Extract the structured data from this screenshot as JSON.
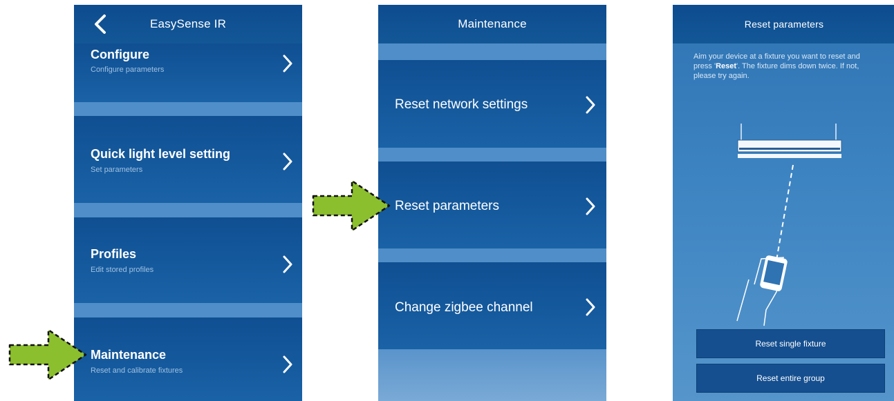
{
  "screen1": {
    "title": "EasySense IR",
    "items": [
      {
        "title": "Configure",
        "subtitle": "Configure parameters"
      },
      {
        "title": "Quick light level setting",
        "subtitle": "Set parameters"
      },
      {
        "title": "Profiles",
        "subtitle": "Edit stored profiles"
      },
      {
        "title": "Maintenance",
        "subtitle": "Reset and calibrate fixtures"
      }
    ]
  },
  "screen2": {
    "title": "Maintenance",
    "items": [
      {
        "title": "Reset network settings"
      },
      {
        "title": "Reset parameters"
      },
      {
        "title": "Change zigbee channel"
      }
    ]
  },
  "screen3": {
    "title": "Reset parameters",
    "description_before": "Aim your device at a fixture you want to reset and press '",
    "description_bold": "Reset",
    "description_after": "'. The fixture dims down twice. If not, please try again.",
    "buttons": {
      "single": "Reset single fixture",
      "group": "Reset entire group"
    }
  },
  "colors": {
    "highlight_arrow": "#8cbf2e",
    "accent_blue": "#1b5c98"
  }
}
